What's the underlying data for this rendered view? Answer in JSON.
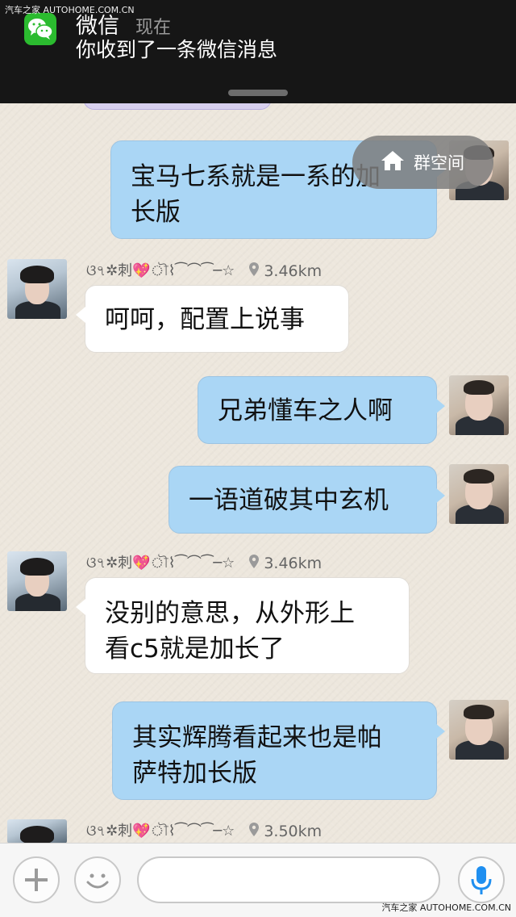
{
  "watermark": {
    "top": "汽车之家  AUTOHOME.COM.CN",
    "bottom": "汽车之家  AUTOHOME.COM.CN"
  },
  "notification": {
    "app_name": "微信",
    "time": "现在",
    "message": "你收到了一条微信消息",
    "icon": "wechat-icon"
  },
  "group_space": {
    "label": "群空间",
    "icon": "home-icon"
  },
  "messages": [
    {
      "from": "self",
      "text_lines": [
        "宝马七系就是一系的加",
        "长版"
      ]
    },
    {
      "from": "other",
      "sender": "ଓ৭✲刺💖ৗ⌇⁀⌒⁀─☆",
      "distance": "3.46km",
      "text_lines": [
        "呵呵，配置上说事"
      ]
    },
    {
      "from": "self",
      "text_lines": [
        "兄弟懂车之人啊"
      ]
    },
    {
      "from": "self",
      "text_lines": [
        "一语道破其中玄机"
      ]
    },
    {
      "from": "other",
      "sender": "ଓ৭✲刺💖ৗ⌇⁀⌒⁀─☆",
      "distance": "3.46km",
      "text_lines": [
        "没别的意思，从外形上",
        "看c5就是加长了"
      ]
    },
    {
      "from": "self",
      "text_lines": [
        "其实辉腾看起来也是帕",
        "萨特加长版"
      ]
    },
    {
      "from": "other",
      "sender": "ଓ৭✲刺💖ৗ⌇⁀⌒⁀─☆",
      "distance": "3.50km",
      "text_lines": []
    }
  ],
  "input_bar": {
    "add_icon": "plus-icon",
    "emoji_icon": "smiley-icon",
    "voice_icon": "microphone-icon",
    "text_value": ""
  },
  "colors": {
    "self_bubble": "#aad6f5",
    "other_bubble": "#ffffff",
    "notification_bg": "#161616",
    "wechat_green": "#2bbb2f",
    "mic_blue": "#1f8ff0"
  }
}
